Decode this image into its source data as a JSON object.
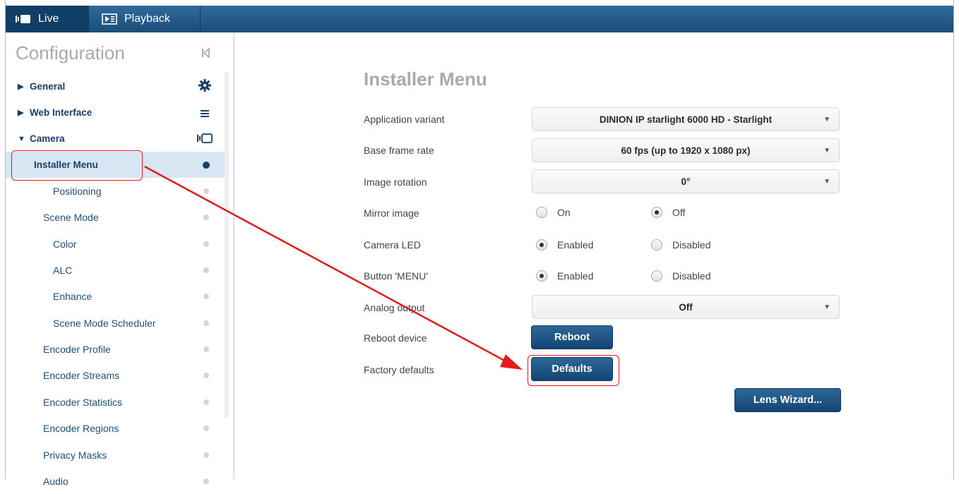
{
  "topbar": {
    "tabs": [
      {
        "label": "Live",
        "icon": "camera-icon"
      },
      {
        "label": "Playback",
        "icon": "playback-icon"
      }
    ]
  },
  "sidebar": {
    "title": "Configuration",
    "items": [
      {
        "label": "General",
        "state": "collapsed",
        "icon": "gear-icon"
      },
      {
        "label": "Web Interface",
        "state": "collapsed",
        "icon": "menu-lines-icon"
      },
      {
        "label": "Camera",
        "state": "expanded",
        "icon": "camera-icon"
      },
      {
        "label": "Installer Menu",
        "selected": true
      },
      {
        "label": "Positioning"
      },
      {
        "label": "Scene Mode"
      },
      {
        "label": "Color"
      },
      {
        "label": "ALC"
      },
      {
        "label": "Enhance"
      },
      {
        "label": "Scene Mode Scheduler"
      },
      {
        "label": "Encoder Profile"
      },
      {
        "label": "Encoder Streams"
      },
      {
        "label": "Encoder Statistics"
      },
      {
        "label": "Encoder Regions"
      },
      {
        "label": "Privacy Masks"
      },
      {
        "label": "Audio"
      }
    ]
  },
  "main": {
    "title": "Installer Menu",
    "application_variant": {
      "label": "Application variant",
      "value": "DINION IP starlight 6000 HD - Starlight"
    },
    "base_frame_rate": {
      "label": "Base frame rate",
      "value": "60 fps (up to 1920 x 1080 px)"
    },
    "image_rotation": {
      "label": "Image rotation",
      "value": "0°"
    },
    "mirror_image": {
      "label": "Mirror image",
      "options": [
        "On",
        "Off"
      ],
      "selected": "Off"
    },
    "camera_led": {
      "label": "Camera LED",
      "options": [
        "Enabled",
        "Disabled"
      ],
      "selected": "Enabled"
    },
    "button_menu": {
      "label": "Button 'MENU'",
      "options": [
        "Enabled",
        "Disabled"
      ],
      "selected": "Enabled"
    },
    "analog_output": {
      "label": "Analog output",
      "value": "Off"
    },
    "reboot": {
      "label": "Reboot device",
      "button": "Reboot"
    },
    "factory_defaults": {
      "label": "Factory defaults",
      "button": "Defaults"
    },
    "lens_wizard": {
      "button": "Lens Wizard..."
    }
  },
  "colors": {
    "topbar": "#1b4d78",
    "nav_text": "#1d4f7b",
    "button": "#134573",
    "highlight": "#e31b1b",
    "selected_row": "#d7e6f2"
  }
}
